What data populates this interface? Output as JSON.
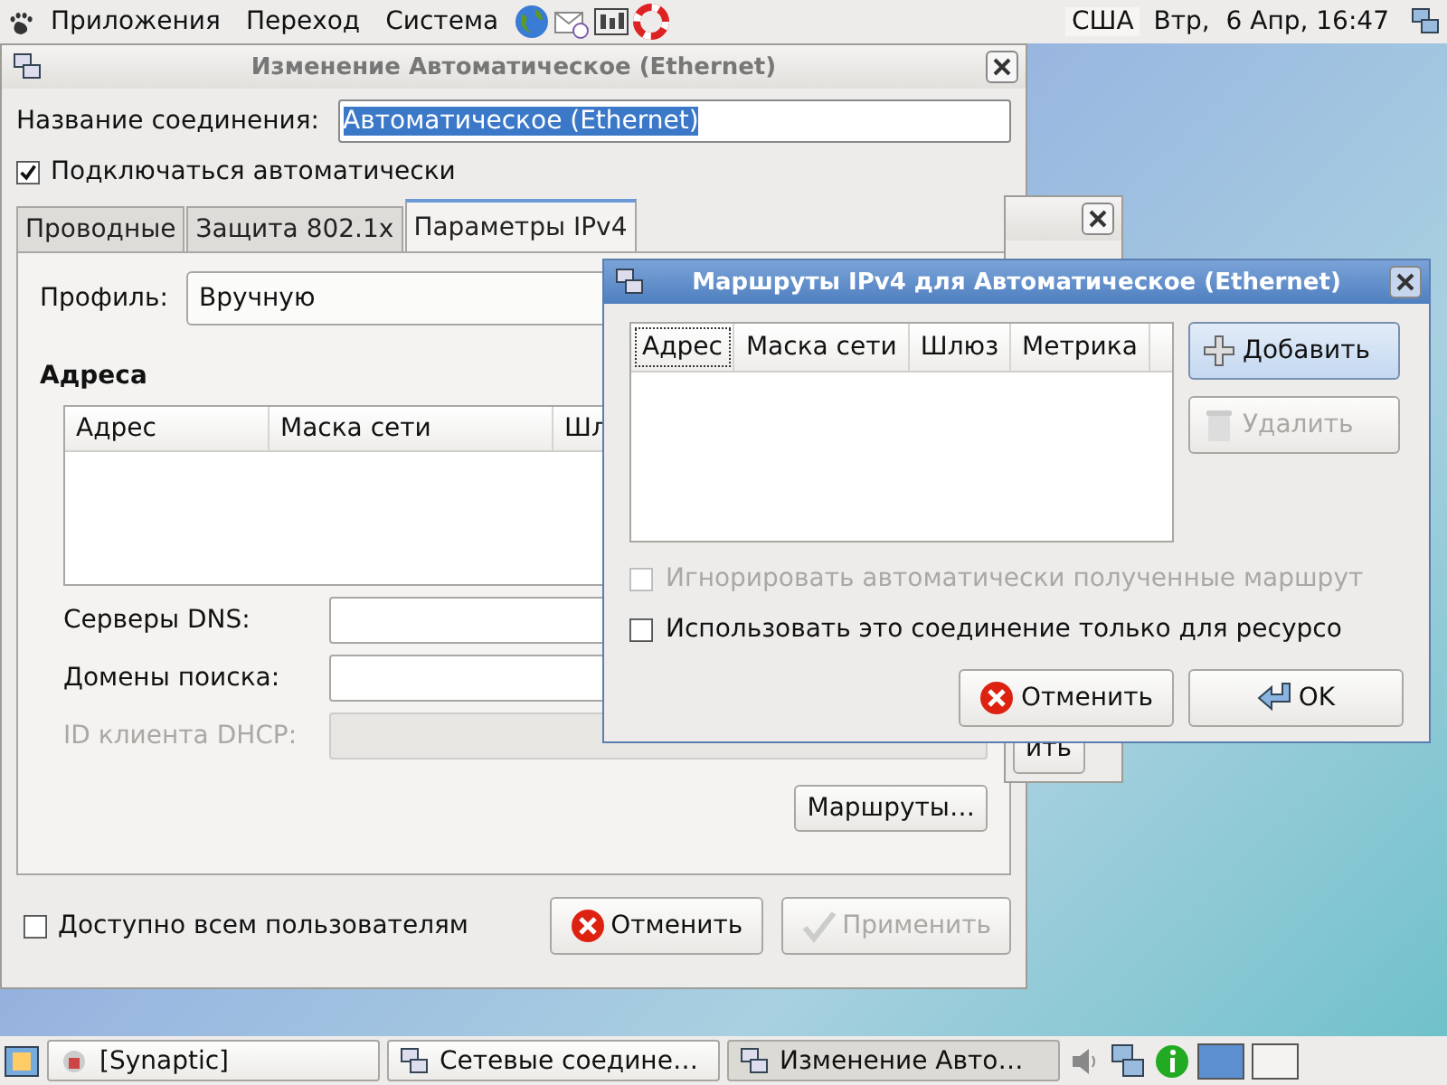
{
  "top_panel": {
    "menus": [
      "Приложения",
      "Переход",
      "Система"
    ],
    "keyboard_layout": "США",
    "clock": "Втр,  6 Апр, 16:47"
  },
  "main_window": {
    "title": "Изменение Автоматическое (Ethernet)",
    "name_label": "Название соединения:",
    "name_value": "Автоматическое (Ethernet)",
    "auto_connect": {
      "label": "Подключаться автоматически",
      "checked": true
    },
    "tabs": [
      {
        "label": "Проводные",
        "selected": false
      },
      {
        "label": "Защита 802.1x",
        "selected": false
      },
      {
        "label": "Параметры IPv4",
        "selected": true
      }
    ],
    "profile_label": "Профиль:",
    "profile_value": "Вручную",
    "addresses_heading": "Адреса",
    "address_columns": [
      "Адрес",
      "Маска сети",
      "Шл"
    ],
    "fields": [
      {
        "label": "Серверы DNS:",
        "disabled": false
      },
      {
        "label": "Домены поиска:",
        "disabled": false
      },
      {
        "label": "ID клиента DHCP:",
        "disabled": true
      }
    ],
    "routes_button": "Маршруты…",
    "all_users": {
      "label": "Доступно всем пользователям",
      "checked": false
    },
    "buttons": [
      {
        "label": "Отменить",
        "kind": "cancel",
        "disabled": false
      },
      {
        "label": "Применить",
        "kind": "apply",
        "disabled": true
      }
    ]
  },
  "back_window": {
    "button_text": "ить"
  },
  "routes_window": {
    "title": "Маршруты IPv4 для Автоматическое (Ethernet)",
    "columns": [
      "Адрес",
      "Маска сети",
      "Шлюз",
      "Метрика"
    ],
    "side_buttons": [
      {
        "label": "Добавить",
        "kind": "add",
        "disabled": false
      },
      {
        "label": "Удалить",
        "kind": "delete",
        "disabled": true
      }
    ],
    "checks": [
      {
        "label": "Игнорировать автоматически полученные маршрут",
        "checked": false,
        "disabled": true
      },
      {
        "label": "Использовать это соединение только для ресурсо",
        "checked": false,
        "disabled": false
      }
    ],
    "buttons": [
      {
        "label": "Отменить",
        "kind": "cancel"
      },
      {
        "label": "OK",
        "kind": "ok"
      }
    ]
  },
  "taskbar": {
    "tasks": [
      {
        "label": "[Synaptic]",
        "kind": "synaptic",
        "selected": false
      },
      {
        "label": "Сетевые соедине…",
        "kind": "network",
        "selected": false
      },
      {
        "label": "Изменение Авто…",
        "kind": "network",
        "selected": true
      }
    ]
  }
}
